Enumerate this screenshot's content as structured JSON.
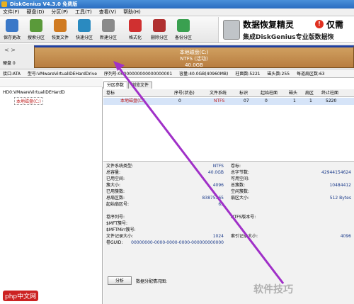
{
  "window": {
    "title": "DiskGenius V4.3.0 免费版"
  },
  "menu": [
    "文件(F)",
    "硬盘(D)",
    "分区(P)",
    "工具(T)",
    "查看(V)",
    "帮助(H)"
  ],
  "toolbar": [
    {
      "label": "保存更改",
      "color": "#3a78c8"
    },
    {
      "label": "搜索分区",
      "color": "#5a9a3a"
    },
    {
      "label": "恢复文件",
      "color": "#d07a20"
    },
    {
      "label": "快速分区",
      "color": "#2a8ac0"
    },
    {
      "label": "新建分区",
      "color": "#8a8a8a"
    },
    {
      "label": "格式化",
      "color": "#d03030"
    },
    {
      "label": "删除分区",
      "color": "#b03030"
    },
    {
      "label": "备份分区",
      "color": "#3aa050"
    }
  ],
  "banner": {
    "line1": "数据恢复精灵",
    "line2": "集成DiskGenius专业版数据恢",
    "line3": "仅需"
  },
  "disk_strip": {
    "nav": "< >",
    "label": "硬盘 0"
  },
  "partition_bar": {
    "name": "本地磁盘(C:)",
    "fs": "NTFS (活动)",
    "size": "40.0GB"
  },
  "info": {
    "iface": "接口:ATA",
    "model": "型号:VMwareVirtualIDEHardDrive",
    "serial": "序列号:00000000000000000001",
    "capacity": "容量:40.0GB(40960MB)",
    "cylinders": "柱面数:5221",
    "heads": "磁头数:255",
    "sectors": "每道扇区数:63"
  },
  "tree": {
    "disk": "HD0:VMwareVirtualIDEHardD",
    "partition": "本地磁盘(C:)"
  },
  "tabs": [
    "分区参数",
    "浏览文件"
  ],
  "grid_headers": [
    "卷标",
    "序号(状态)",
    "文件系统",
    "标识",
    "起始柱面",
    "磁头",
    "扇区",
    "终止柱面"
  ],
  "grid_row": [
    "本地磁盘(C:)",
    "0",
    "NTFS",
    "07",
    "0",
    "1",
    "1",
    "5220"
  ],
  "fs_info": [
    {
      "l": "文件系统类型:",
      "v": "NTFS",
      "l2": "卷标:",
      "v2": ""
    },
    {
      "l": "总容量:",
      "v": "40.0GB",
      "l2": "总字节数:",
      "v2": "42944154624"
    },
    {
      "l": "已用空间:",
      "v": "",
      "l2": "可用空间:",
      "v2": ""
    },
    {
      "l": "簇大小:",
      "v": "4096",
      "l2": "总簇数:",
      "v2": "10484412"
    },
    {
      "l": "已用簇数:",
      "v": "",
      "l2": "空闲簇数:",
      "v2": ""
    },
    {
      "l": "总扇区数:",
      "v": "83875365",
      "l2": "扇区大小:",
      "v2": "512 Bytes"
    },
    {
      "l": "起始扇区号:",
      "v": "63",
      "l2": "",
      "v2": ""
    },
    {
      "l": "",
      "v": "",
      "l2": "",
      "v2": ""
    },
    {
      "l": "卷序列号:",
      "v": "",
      "l2": "NTFS版本号:",
      "v2": ""
    },
    {
      "l": "$MFT簇号:",
      "v": "",
      "l2": "",
      "v2": ""
    },
    {
      "l": "$MFTMirr簇号:",
      "v": "",
      "l2": "",
      "v2": ""
    },
    {
      "l": "文件记录大小:",
      "v": "1024",
      "l2": "索引记录大小:",
      "v2": "4096"
    },
    {
      "l": "卷GUID:",
      "v": "00000000-0000-0000-0000-000000000000",
      "l2": "",
      "v2": ""
    }
  ],
  "bottom": {
    "analyze": "分析",
    "alloc": "数据分配情况图:"
  },
  "watermark": {
    "text": "软件技巧",
    "site": "php中文网"
  }
}
